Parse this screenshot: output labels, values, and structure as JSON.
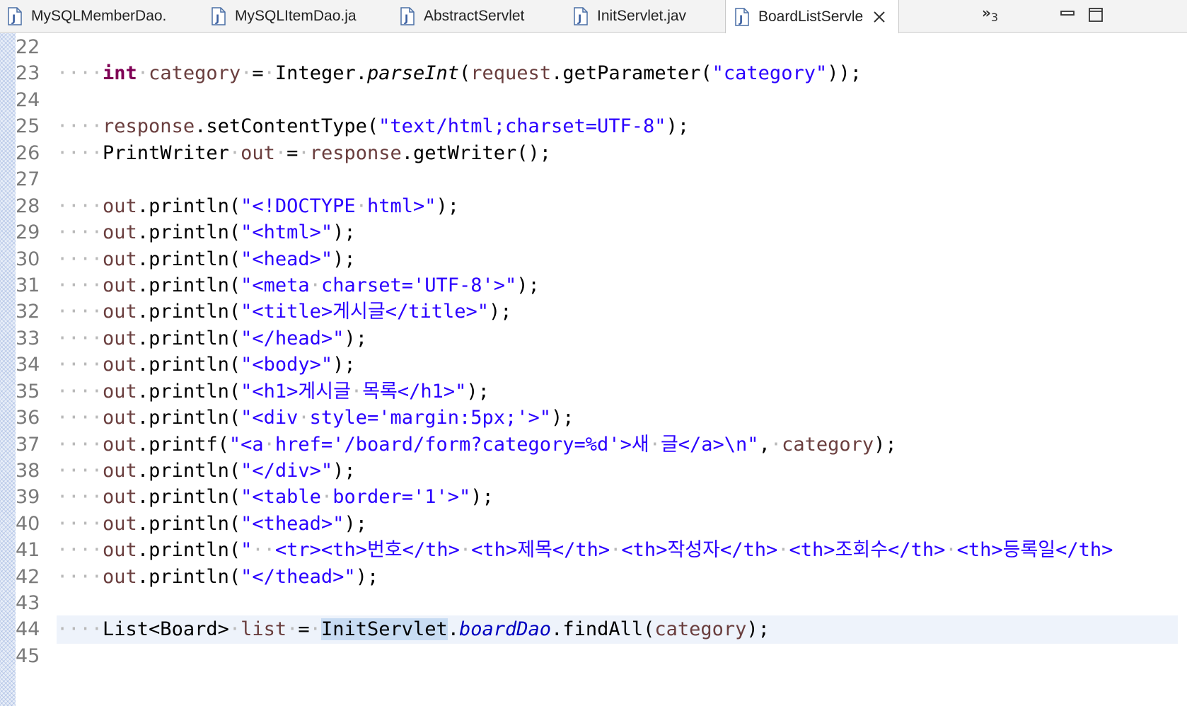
{
  "tabs": [
    {
      "label": "MySQLMemberDao.",
      "icon": "java-file-icon",
      "active": false
    },
    {
      "label": "MySQLItemDao.ja",
      "icon": "java-file-icon",
      "active": false
    },
    {
      "label": "AbstractServlet",
      "icon": "java-file-icon",
      "active": false
    },
    {
      "label": "InitServlet.jav",
      "icon": "java-file-icon",
      "active": false
    },
    {
      "label": "BoardListServle",
      "icon": "java-file-icon",
      "active": true
    }
  ],
  "overflow": {
    "chevrons": "»",
    "count": "3"
  },
  "colors": {
    "keyword": "#7f0055",
    "local_variable": "#6a3e3e",
    "string": "#2a00ff",
    "field": "#0000c0",
    "whitespace_marker": "#b9b9b9",
    "current_line": "#eef3fb",
    "occurrence_highlight": "#c8dcf3",
    "line_number": "#7a7a7a"
  },
  "editor": {
    "lines": [
      {
        "n": "22"
      },
      {
        "n": "23",
        "ws": "····",
        "t1": "int",
        "s1": "·",
        "t2": "category",
        "s2": "·",
        "t3": "=",
        "s3": "·",
        "t4": "Integer.",
        "t5": "parseInt",
        "t6": "(",
        "t7": "request",
        "t8": ".getParameter(",
        "t9": "\"category\"",
        "t10": "));"
      },
      {
        "n": "24"
      },
      {
        "n": "25",
        "ws": "····",
        "t1": "response",
        "t2": ".setContentType(",
        "t3": "\"text/html;charset=UTF-8\"",
        "t4": ");"
      },
      {
        "n": "26",
        "ws": "····",
        "t1": "PrintWriter",
        "s1": "·",
        "t2": "out",
        "s2": "·",
        "t3": "=",
        "s3": "·",
        "t4": "response",
        "t5": ".getWriter();"
      },
      {
        "n": "27"
      },
      {
        "n": "28",
        "ws": "····",
        "t1": "out",
        "t2": ".println(",
        "t3": "\"<!DOCTYPE",
        "s1": "·",
        "t4": "html>\"",
        "t5": ");"
      },
      {
        "n": "29",
        "ws": "····",
        "t1": "out",
        "t2": ".println(",
        "t3": "\"<html>\"",
        "t5": ");"
      },
      {
        "n": "30",
        "ws": "····",
        "t1": "out",
        "t2": ".println(",
        "t3": "\"<head>\"",
        "t5": ");"
      },
      {
        "n": "31",
        "ws": "····",
        "t1": "out",
        "t2": ".println(",
        "t3": "\"<meta",
        "s1": "·",
        "t4": "charset='UTF-8'>\"",
        "t5": ");"
      },
      {
        "n": "32",
        "ws": "····",
        "t1": "out",
        "t2": ".println(",
        "t3": "\"<title>게시글</title>\"",
        "t5": ");"
      },
      {
        "n": "33",
        "ws": "····",
        "t1": "out",
        "t2": ".println(",
        "t3": "\"</head>\"",
        "t5": ");"
      },
      {
        "n": "34",
        "ws": "····",
        "t1": "out",
        "t2": ".println(",
        "t3": "\"<body>\"",
        "t5": ");"
      },
      {
        "n": "35",
        "ws": "····",
        "t1": "out",
        "t2": ".println(",
        "t3": "\"<h1>게시글",
        "s1": "·",
        "t4": "목록</h1>\"",
        "t5": ");"
      },
      {
        "n": "36",
        "ws": "····",
        "t1": "out",
        "t2": ".println(",
        "t3": "\"<div",
        "s1": "·",
        "t4": "style='margin:5px;'>\"",
        "t5": ");"
      },
      {
        "n": "37",
        "ws": "····",
        "t1": "out",
        "t2": ".printf(",
        "t3": "\"<a",
        "s1": "·",
        "t4": "href='/board/form?category=%d'>새",
        "s2": "·",
        "t5": "글</a>\\n\"",
        "t6": ",",
        "s3": "·",
        "t7": "category",
        "t8": ");"
      },
      {
        "n": "38",
        "ws": "····",
        "t1": "out",
        "t2": ".println(",
        "t3": "\"</div>\"",
        "t5": ");"
      },
      {
        "n": "39",
        "ws": "····",
        "t1": "out",
        "t2": ".println(",
        "t3": "\"<table",
        "s1": "·",
        "t4": "border='1'>\"",
        "t5": ");"
      },
      {
        "n": "40",
        "ws": "····",
        "t1": "out",
        "t2": ".println(",
        "t3": "\"<thead>\"",
        "t5": ");"
      },
      {
        "n": "41",
        "ws": "····",
        "t1": "out",
        "t2": ".println(",
        "t3": "\"",
        "s1": "··",
        "t4": "<tr><th>번호</th>",
        "s2": "·",
        "t5": "<th>제목</th>",
        "s3": "·",
        "t6": "<th>작성자</th>",
        "s4": "·",
        "t7": "<th>조회수</th>",
        "s5": "·",
        "t8": "<th>등록일</th>"
      },
      {
        "n": "42",
        "ws": "····",
        "t1": "out",
        "t2": ".println(",
        "t3": "\"</thead>\"",
        "t5": ");"
      },
      {
        "n": "43"
      },
      {
        "n": "44",
        "ws": "····",
        "t1": "List<Board>",
        "s1": "·",
        "t2": "list",
        "s2": "·",
        "t3": "=",
        "s3": "·",
        "t4": "InitServlet",
        "t5": ".",
        "t6": "boardDao",
        "t7": ".findAll(",
        "t8": "category",
        "t9": ");"
      },
      {
        "n": "45"
      }
    ]
  }
}
